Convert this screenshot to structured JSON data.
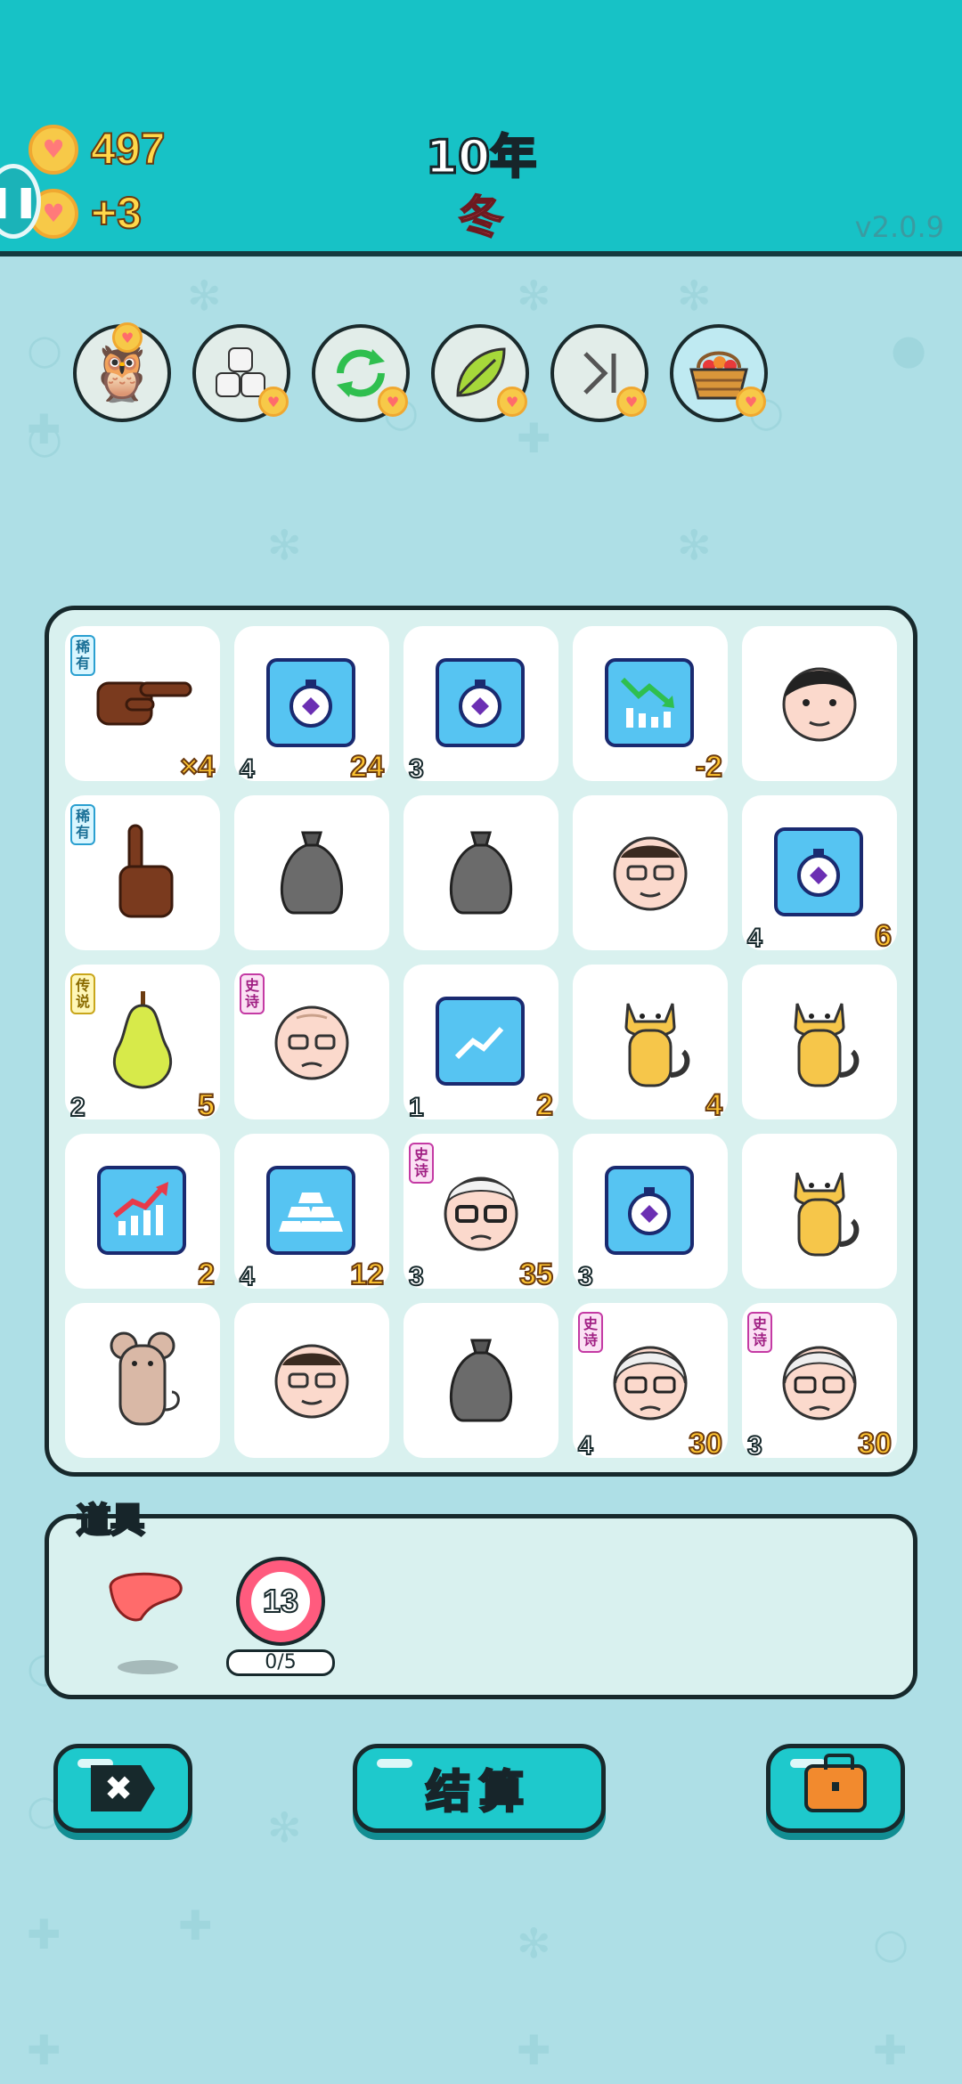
{
  "header": {
    "coins": "497",
    "coins_delta": "+3",
    "year": "10年",
    "season": "冬",
    "version": "v2.0.9"
  },
  "tools": [
    {
      "name": "owl",
      "icon": "owl-mask-icon"
    },
    {
      "name": "blocks",
      "icon": "blocks-icon"
    },
    {
      "name": "refresh",
      "icon": "refresh-arrows-icon"
    },
    {
      "name": "leaf",
      "icon": "leaf-icon"
    },
    {
      "name": "skip",
      "icon": "skip-icon"
    },
    {
      "name": "basket",
      "icon": "fruit-basket-icon"
    }
  ],
  "board": {
    "cells": [
      {
        "icon": "pointing-hand-right-icon",
        "badge": "稀有",
        "left": "",
        "right": "×4"
      },
      {
        "icon": "stopwatch-boost-icon",
        "badge": "",
        "left": "4",
        "right": "24"
      },
      {
        "icon": "stopwatch-boost-icon",
        "badge": "",
        "left": "3",
        "right": ""
      },
      {
        "icon": "chart-down-boost-icon",
        "badge": "",
        "left": "",
        "right": "-2"
      },
      {
        "icon": "young-man-face-icon",
        "badge": "",
        "left": "",
        "right": ""
      },
      {
        "icon": "pointing-hand-up-icon",
        "badge": "稀有",
        "left": "",
        "right": ""
      },
      {
        "icon": "garbage-bag-icon",
        "badge": "",
        "left": "",
        "right": ""
      },
      {
        "icon": "garbage-bag-icon",
        "badge": "",
        "left": "",
        "right": ""
      },
      {
        "icon": "old-man-glasses-face-icon",
        "badge": "",
        "left": "",
        "right": ""
      },
      {
        "icon": "stopwatch-boost-icon",
        "badge": "",
        "left": "4",
        "right": "6"
      },
      {
        "icon": "pear-icon",
        "badge": "传说",
        "left": "2",
        "right": "5"
      },
      {
        "icon": "bald-old-man-face-icon",
        "badge": "史诗",
        "left": "",
        "right": ""
      },
      {
        "icon": "chart-up-boost-icon",
        "badge": "",
        "left": "1",
        "right": "2"
      },
      {
        "icon": "orange-cat-icon",
        "badge": "",
        "left": "",
        "right": "4"
      },
      {
        "icon": "orange-cat-icon",
        "badge": "",
        "left": "",
        "right": ""
      },
      {
        "icon": "bar-chart-up-boost-icon",
        "badge": "",
        "left": "",
        "right": "2"
      },
      {
        "icon": "gold-bars-boost-icon",
        "badge": "",
        "left": "4",
        "right": "12"
      },
      {
        "icon": "grandpa-face-icon",
        "badge": "史诗",
        "left": "3",
        "right": "35"
      },
      {
        "icon": "stopwatch-boost-icon",
        "badge": "",
        "left": "3",
        "right": ""
      },
      {
        "icon": "orange-cat-icon",
        "badge": "",
        "left": "",
        "right": ""
      },
      {
        "icon": "mouse-icon",
        "badge": "",
        "left": "",
        "right": ""
      },
      {
        "icon": "old-man-glasses-face-icon",
        "badge": "",
        "left": "",
        "right": ""
      },
      {
        "icon": "garbage-bag-icon",
        "badge": "",
        "left": "",
        "right": ""
      },
      {
        "icon": "grandma-face-icon",
        "badge": "史诗",
        "left": "4",
        "right": "30"
      },
      {
        "icon": "grandma-face-icon",
        "badge": "史诗",
        "left": "3",
        "right": "30"
      }
    ]
  },
  "items": {
    "title": "道具",
    "liver_icon": "liver-icon",
    "target_icon": "target-icon",
    "target_count": "13",
    "target_progress": "0/5"
  },
  "buttons": {
    "close_icon": "close-tag-icon",
    "settle_label": "结算",
    "bag_icon": "briefcase-icon"
  },
  "colors": {
    "header_bg": "#17c2c6",
    "page_bg": "#aedfe6",
    "accent_yellow": "#ffc531",
    "season_red": "#ff5b6b"
  }
}
